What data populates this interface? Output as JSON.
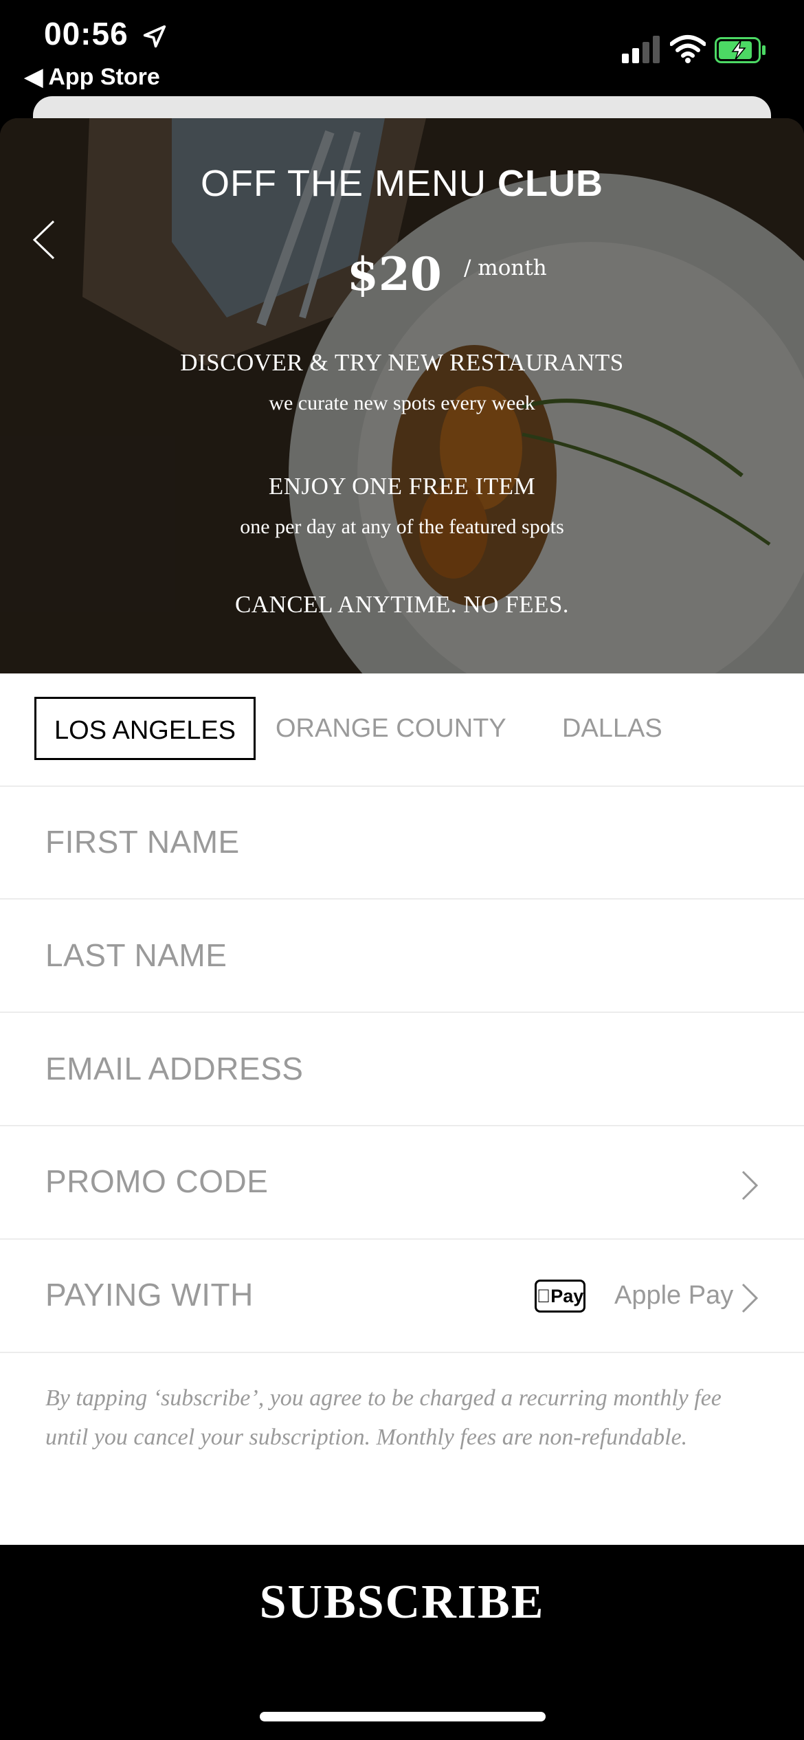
{
  "status": {
    "time": "00:56",
    "back_label": "◀ App Store"
  },
  "hero": {
    "title_light": "OFF THE MENU",
    "title_bold": "CLUB",
    "price": "$20",
    "per": "/ month",
    "benefits": [
      {
        "heading": "DISCOVER & TRY NEW RESTAURANTS",
        "sub": "we curate new spots every week"
      },
      {
        "heading": "ENJOY ONE FREE ITEM",
        "sub": "one per day at any of the featured spots"
      },
      {
        "heading": "CANCEL ANYTIME. NO FEES.",
        "sub": ""
      }
    ]
  },
  "tabs": [
    {
      "label": "LOS ANGELES",
      "active": true
    },
    {
      "label": "ORANGE COUNTY",
      "active": false
    },
    {
      "label": "DALLAS",
      "active": false
    }
  ],
  "form": {
    "first_name": "FIRST NAME",
    "last_name": "LAST NAME",
    "email": "EMAIL ADDRESS",
    "promo": "PROMO CODE",
    "paying_with": "PAYING WITH",
    "payment_badge": "Pay",
    "payment_method": "Apple Pay"
  },
  "disclaimer": "By tapping ‘subscribe’, you agree to be charged a recurring monthly fee until you cancel your subscription. Monthly fees are non-refundable.",
  "subscribe_label": "SUBSCRIBE",
  "colors": {
    "background": "#000000",
    "placeholder": "#9a9a9a",
    "battery": "#4cd964"
  }
}
